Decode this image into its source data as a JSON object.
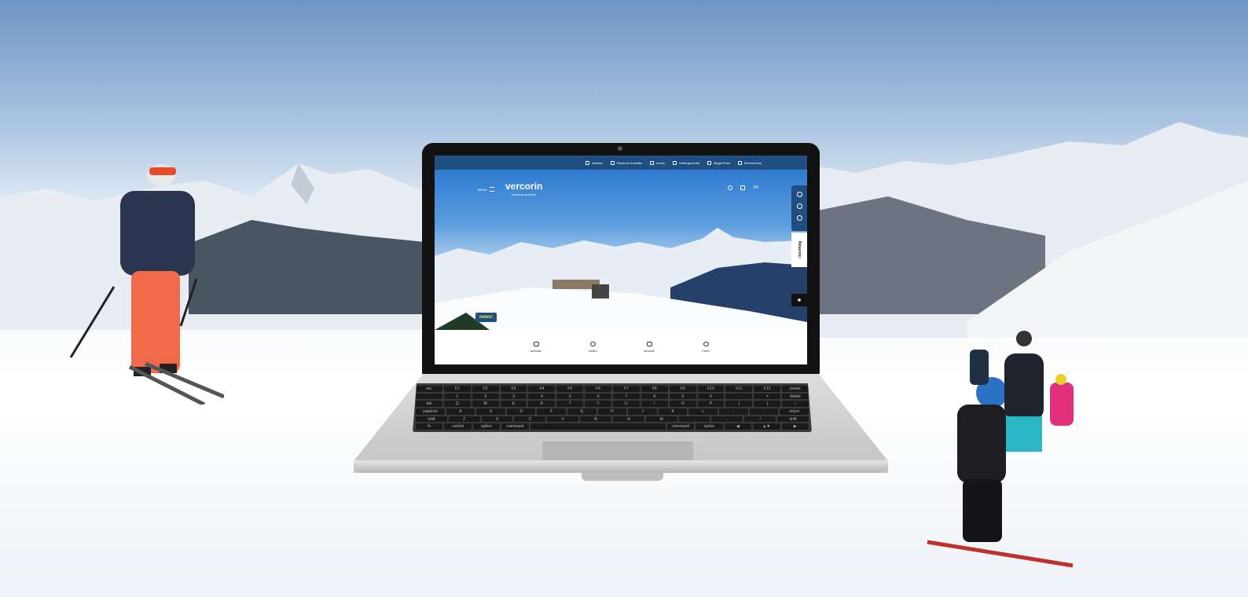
{
  "website": {
    "topbar": [
      {
        "label": "Acheter",
        "icon": "bag-icon"
      },
      {
        "label": "Réserver Activités",
        "icon": "pin-icon"
      },
      {
        "label": "Accès",
        "icon": "car-icon"
      },
      {
        "label": "Hébergements",
        "icon": "bed-icon"
      },
      {
        "label": "Magic Pass",
        "icon": "ticket-icon"
      },
      {
        "label": "Événements",
        "icon": "calendar-icon"
      }
    ],
    "menu_label": "MENU",
    "brand": "vercorin",
    "tagline": "SUPREME SIESTURE",
    "language": "FR",
    "sidebar_reserve": "Réserver",
    "news_badge": "news!",
    "bottom_items": [
      {
        "label": "webcam",
        "icon": "webcam-icon"
      },
      {
        "label": "météo",
        "icon": "sun-icon"
      },
      {
        "label": "infoclair",
        "icon": "lift-icon"
      },
      {
        "label": "Carte",
        "icon": "map-icon"
      }
    ]
  },
  "keyboard": {
    "rows": [
      [
        "esc",
        "F1",
        "F2",
        "F3",
        "F4",
        "F5",
        "F6",
        "F7",
        "F8",
        "F9",
        "F10",
        "F11",
        "F12",
        "power"
      ],
      [
        "`",
        "1",
        "2",
        "3",
        "4",
        "5",
        "6",
        "7",
        "8",
        "9",
        "0",
        "-",
        "=",
        "delete"
      ],
      [
        "tab",
        "Q",
        "W",
        "E",
        "R",
        "T",
        "Y",
        "U",
        "I",
        "O",
        "P",
        "[",
        "]",
        "\\"
      ],
      [
        "capslock",
        "A",
        "S",
        "D",
        "F",
        "G",
        "H",
        "J",
        "K",
        "L",
        ";",
        "'",
        "return"
      ],
      [
        "shift",
        "Z",
        "X",
        "C",
        "V",
        "B",
        "N",
        "M",
        ",",
        ".",
        "/",
        "shift"
      ],
      [
        "fn",
        "control",
        "option",
        "command",
        "",
        "command",
        "option",
        "◀",
        "▲▼",
        "▶"
      ]
    ]
  }
}
